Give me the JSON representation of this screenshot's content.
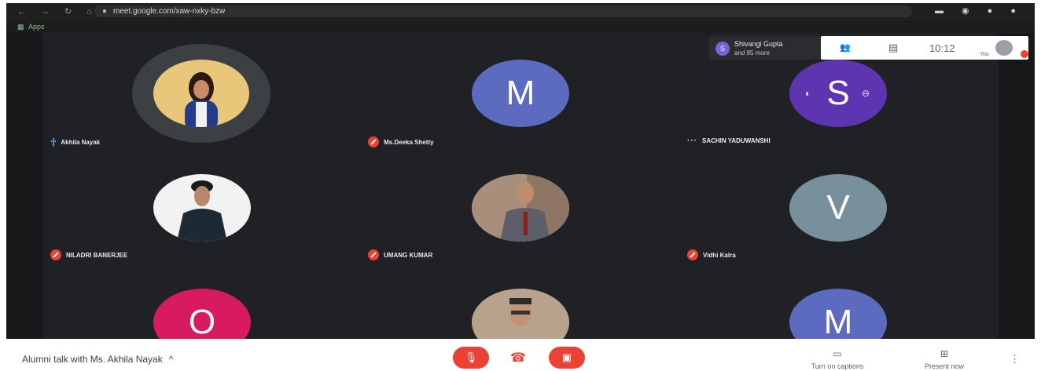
{
  "browser": {
    "url": "meet.google.com/xaw-nxky-bzw",
    "bookmarks_label": "Apps"
  },
  "overlay": {
    "participants_initial": "S",
    "participants_name": "Shivangi Gupta",
    "participants_more": "and 85 more",
    "time": "10:12",
    "you_label": "You"
  },
  "participants": [
    {
      "name": "Akhila Nayak",
      "type": "photo",
      "status": "speaking"
    },
    {
      "name": "Ms.Deeka Shetty",
      "type": "initial",
      "initial": "M",
      "color": "#5c6bc0",
      "status": "muted"
    },
    {
      "name": "SACHIN YADUWANSHI",
      "type": "initial",
      "initial": "S",
      "color": "#5e35b1",
      "status": "more"
    },
    {
      "name": "NILADRI BANERJEE",
      "type": "photo",
      "status": "muted"
    },
    {
      "name": "UMANG KUMAR",
      "type": "photo",
      "status": "muted"
    },
    {
      "name": "Vidhi Kalra",
      "type": "initial",
      "initial": "V",
      "color": "#78909c",
      "status": "muted"
    },
    {
      "name": "",
      "type": "initial",
      "initial": "O",
      "color": "#d81b60"
    },
    {
      "name": "",
      "type": "photo"
    },
    {
      "name": "",
      "type": "initial",
      "initial": "M",
      "color": "#5c6bc0"
    }
  ],
  "bottom_bar": {
    "meeting_title": "Alumni talk with Ms. Akhila Nayak",
    "turn_on_captions": "Turn on captions",
    "present_now": "Present now"
  }
}
